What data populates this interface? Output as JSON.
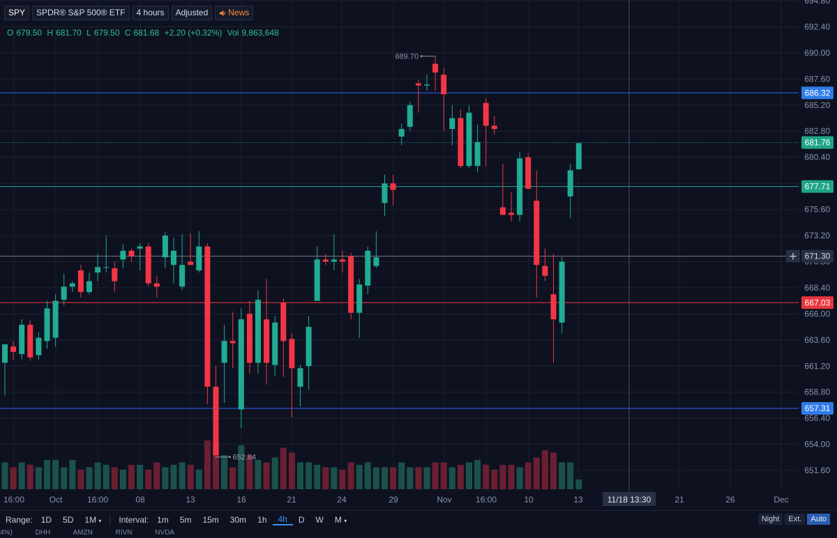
{
  "header": {
    "symbol": "SPY",
    "name": "SPDR® S&P 500® ETF",
    "timeframe": "4 hours",
    "mode": "Adjusted",
    "news": "News"
  },
  "ohlc": {
    "o_label": "O",
    "o": "679.50",
    "h_label": "H",
    "h": "681.70",
    "l_label": "L",
    "l": "679.50",
    "c_label": "C",
    "c": "681.68",
    "change": "+2.20 (+0.32%)",
    "vol_label": "Vol",
    "vol": "9,863,648"
  },
  "bottom_bar": {
    "range_label": "Range:",
    "ranges": [
      "1D",
      "5D",
      "1M"
    ],
    "interval_label": "Interval:",
    "intervals": [
      "1m",
      "5m",
      "15m",
      "30m",
      "1h",
      "4h",
      "D",
      "W",
      "M"
    ],
    "active_interval": "4h",
    "toggles": [
      "Night",
      "Ext.",
      "Auto"
    ]
  },
  "ticker_strip": [
    "4%)",
    "DHH",
    "AMZN",
    "RIVN",
    "NVDA"
  ],
  "colors": {
    "up": "#22ab94",
    "down": "#f23645",
    "bg": "#0e1220",
    "line_blue": "#2962ff",
    "line_green": "#26a69a",
    "line_red": "#f23645",
    "line_grey": "#787b86"
  },
  "chart_data": {
    "type": "candlestick",
    "symbol": "SPY",
    "ylim": [
      650,
      694.8
    ],
    "yticks": [
      651.6,
      654.0,
      656.4,
      658.8,
      661.2,
      663.6,
      666.0,
      668.4,
      670.8,
      673.2,
      675.6,
      678.0,
      680.4,
      682.8,
      685.2,
      687.6,
      690.0,
      692.4,
      694.8
    ],
    "xticks": [
      "16:00",
      "Oct",
      "16:00",
      "08",
      "13",
      "16",
      "21",
      "24",
      "29",
      "Nov",
      "16:00",
      "10",
      "13",
      "21",
      "26",
      "Dec"
    ],
    "crosshair_x_label": "11/18 13:30",
    "candles": [
      {
        "o": 661.5,
        "h": 663.0,
        "l": 658.5,
        "c": 663.2
      },
      {
        "o": 663.0,
        "h": 663.5,
        "l": 661.8,
        "c": 662.5
      },
      {
        "o": 662.3,
        "h": 665.5,
        "l": 661.8,
        "c": 665.0
      },
      {
        "o": 665.0,
        "h": 665.4,
        "l": 661.7,
        "c": 662.0
      },
      {
        "o": 662.2,
        "h": 664.3,
        "l": 661.8,
        "c": 663.8
      },
      {
        "o": 663.5,
        "h": 667.2,
        "l": 662.8,
        "c": 666.5
      },
      {
        "o": 663.8,
        "h": 667.8,
        "l": 663.0,
        "c": 667.2
      },
      {
        "o": 667.3,
        "h": 669.7,
        "l": 666.8,
        "c": 668.5
      },
      {
        "o": 668.5,
        "h": 669.0,
        "l": 668.0,
        "c": 668.8
      },
      {
        "o": 670.0,
        "h": 670.5,
        "l": 667.5,
        "c": 668.0
      },
      {
        "o": 668.0,
        "h": 669.8,
        "l": 667.8,
        "c": 669.0
      },
      {
        "o": 669.8,
        "h": 671.5,
        "l": 669.0,
        "c": 670.3
      },
      {
        "o": 670.3,
        "h": 673.2,
        "l": 669.8,
        "c": 670.3
      },
      {
        "o": 670.2,
        "h": 670.8,
        "l": 668.0,
        "c": 669.0
      },
      {
        "o": 671.0,
        "h": 672.4,
        "l": 670.2,
        "c": 671.8
      },
      {
        "o": 671.8,
        "h": 672.0,
        "l": 670.8,
        "c": 671.3
      },
      {
        "o": 672.0,
        "h": 672.5,
        "l": 670.0,
        "c": 672.2
      },
      {
        "o": 672.2,
        "h": 672.5,
        "l": 668.5,
        "c": 668.8
      },
      {
        "o": 668.8,
        "h": 669.5,
        "l": 667.5,
        "c": 668.5
      },
      {
        "o": 671.2,
        "h": 673.5,
        "l": 670.2,
        "c": 673.2
      },
      {
        "o": 670.5,
        "h": 673.0,
        "l": 668.8,
        "c": 671.8
      },
      {
        "o": 668.5,
        "h": 673.3,
        "l": 668.2,
        "c": 670.5
      },
      {
        "o": 670.8,
        "h": 673.4,
        "l": 670.5,
        "c": 670.5
      },
      {
        "o": 670.0,
        "h": 673.6,
        "l": 669.8,
        "c": 672.2
      },
      {
        "o": 672.2,
        "h": 672.5,
        "l": 657.7,
        "c": 659.3
      },
      {
        "o": 659.3,
        "h": 661.2,
        "l": 652.7,
        "c": 653.0
      },
      {
        "o": 661.5,
        "h": 665.0,
        "l": 657.8,
        "c": 663.5
      },
      {
        "o": 663.5,
        "h": 666.2,
        "l": 661.0,
        "c": 663.3
      },
      {
        "o": 657.2,
        "h": 666.5,
        "l": 655.5,
        "c": 665.5
      },
      {
        "o": 666.0,
        "h": 667.2,
        "l": 660.5,
        "c": 661.5
      },
      {
        "o": 661.5,
        "h": 668.2,
        "l": 660.5,
        "c": 667.3
      },
      {
        "o": 665.5,
        "h": 669.2,
        "l": 659.5,
        "c": 661.5
      },
      {
        "o": 661.3,
        "h": 665.8,
        "l": 660.3,
        "c": 665.2
      },
      {
        "o": 667.0,
        "h": 667.4,
        "l": 660.2,
        "c": 663.5
      },
      {
        "o": 663.7,
        "h": 664.2,
        "l": 656.5,
        "c": 661.0
      },
      {
        "o": 659.3,
        "h": 661.3,
        "l": 657.5,
        "c": 661.0
      },
      {
        "o": 661.2,
        "h": 665.8,
        "l": 659.0,
        "c": 664.8
      },
      {
        "o": 667.2,
        "h": 672.2,
        "l": 667.2,
        "c": 671.0
      },
      {
        "o": 671.0,
        "h": 671.5,
        "l": 670.5,
        "c": 670.8
      },
      {
        "o": 670.8,
        "h": 673.3,
        "l": 670.0,
        "c": 671.0
      },
      {
        "o": 671.0,
        "h": 671.8,
        "l": 669.8,
        "c": 670.8
      },
      {
        "o": 671.3,
        "h": 671.6,
        "l": 665.5,
        "c": 666.1
      },
      {
        "o": 666.1,
        "h": 669.2,
        "l": 663.8,
        "c": 668.7
      },
      {
        "o": 668.6,
        "h": 672.2,
        "l": 667.8,
        "c": 671.8
      },
      {
        "o": 670.4,
        "h": 673.6,
        "l": 670.2,
        "c": 671.2
      },
      {
        "o": 676.2,
        "h": 678.8,
        "l": 675.0,
        "c": 678.0
      },
      {
        "o": 678.0,
        "h": 678.8,
        "l": 676.0,
        "c": 677.4
      },
      {
        "o": 682.3,
        "h": 683.5,
        "l": 681.5,
        "c": 683.0
      },
      {
        "o": 683.2,
        "h": 685.5,
        "l": 682.8,
        "c": 685.2
      },
      {
        "o": 687.2,
        "h": 687.5,
        "l": 684.5,
        "c": 687.0
      },
      {
        "o": 687.0,
        "h": 688.0,
        "l": 686.5,
        "c": 687.1
      },
      {
        "o": 689.0,
        "h": 689.7,
        "l": 686.5,
        "c": 688.2
      },
      {
        "o": 688.0,
        "h": 688.6,
        "l": 682.8,
        "c": 686.2
      },
      {
        "o": 683.0,
        "h": 685.2,
        "l": 681.5,
        "c": 684.0
      },
      {
        "o": 684.0,
        "h": 684.8,
        "l": 679.4,
        "c": 679.6
      },
      {
        "o": 679.6,
        "h": 685.2,
        "l": 679.4,
        "c": 684.5
      },
      {
        "o": 679.6,
        "h": 683.4,
        "l": 679.0,
        "c": 681.8
      },
      {
        "o": 685.4,
        "h": 685.8,
        "l": 679.6,
        "c": 683.3
      },
      {
        "o": 683.3,
        "h": 684.2,
        "l": 682.5,
        "c": 683.0
      },
      {
        "o": 675.8,
        "h": 679.8,
        "l": 675.3,
        "c": 675.1
      },
      {
        "o": 675.3,
        "h": 677.2,
        "l": 674.5,
        "c": 675.1
      },
      {
        "o": 675.1,
        "h": 680.9,
        "l": 674.5,
        "c": 680.3
      },
      {
        "o": 680.4,
        "h": 680.8,
        "l": 677.5,
        "c": 677.5
      },
      {
        "o": 676.4,
        "h": 679.2,
        "l": 667.5,
        "c": 670.5
      },
      {
        "o": 670.4,
        "h": 672.0,
        "l": 669.0,
        "c": 669.5
      },
      {
        "o": 667.8,
        "h": 671.5,
        "l": 661.5,
        "c": 665.5
      },
      {
        "o": 665.2,
        "h": 671.2,
        "l": 664.2,
        "c": 670.8
      },
      {
        "o": 676.8,
        "h": 679.8,
        "l": 674.8,
        "c": 679.2
      },
      {
        "o": 679.3,
        "h": 681.7,
        "l": 679.3,
        "c": 681.7
      }
    ],
    "volume_relative": [
      0.55,
      0.45,
      0.55,
      0.5,
      0.45,
      0.6,
      0.6,
      0.45,
      0.6,
      0.4,
      0.45,
      0.55,
      0.5,
      0.45,
      0.4,
      0.5,
      0.5,
      0.4,
      0.55,
      0.45,
      0.5,
      0.55,
      0.5,
      0.4,
      1.0,
      0.95,
      0.7,
      0.45,
      0.9,
      0.7,
      0.6,
      0.55,
      0.65,
      0.85,
      0.75,
      0.55,
      0.55,
      0.5,
      0.45,
      0.45,
      0.4,
      0.55,
      0.5,
      0.55,
      0.45,
      0.45,
      0.45,
      0.55,
      0.45,
      0.45,
      0.45,
      0.55,
      0.55,
      0.45,
      0.5,
      0.55,
      0.6,
      0.5,
      0.4,
      0.5,
      0.5,
      0.45,
      0.55,
      0.65,
      0.8,
      0.75,
      0.55,
      0.55,
      0.2
    ],
    "price_lines": [
      {
        "value": 686.32,
        "color": "#2962ff",
        "label": "686.32"
      },
      {
        "value": 681.76,
        "color": "#26a69a",
        "label": "681.76",
        "dotted": true
      },
      {
        "value": 677.71,
        "color": "#26a69a",
        "label": "677.71"
      },
      {
        "value": 671.3,
        "color": "#787b86",
        "label": "671.30"
      },
      {
        "value": 667.03,
        "color": "#f23645",
        "label": "667.03"
      },
      {
        "value": 657.31,
        "color": "#2962ff",
        "label": "657.31"
      }
    ],
    "annotations": [
      {
        "label": "689.70",
        "price": 689.7,
        "candle": 51
      },
      {
        "label": "652.84",
        "price": 652.84,
        "candle": 25
      }
    ]
  }
}
